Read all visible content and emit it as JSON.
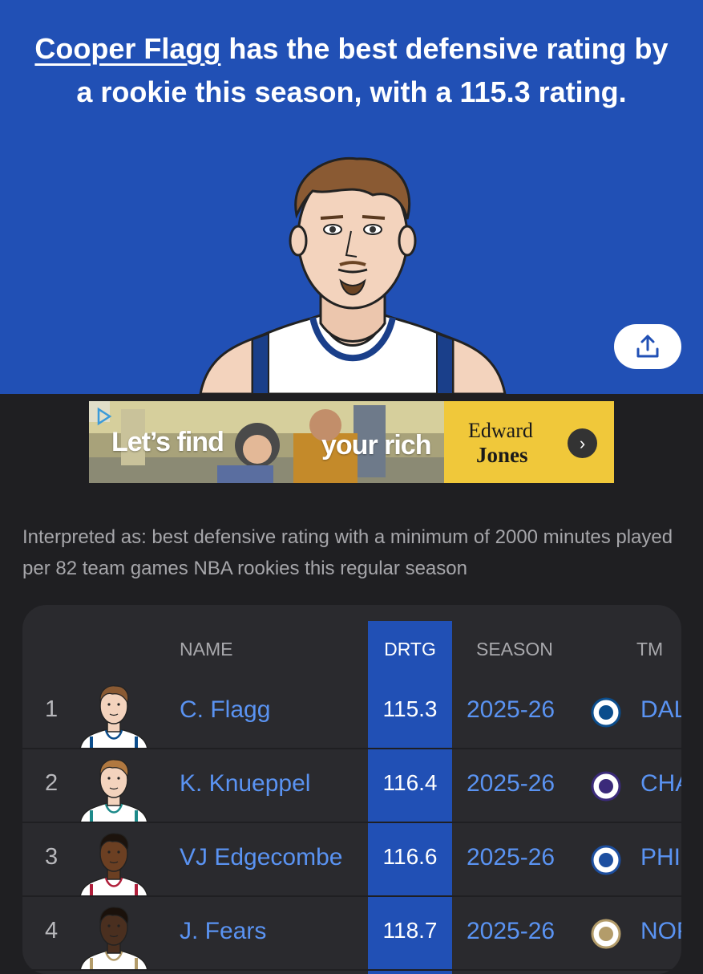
{
  "headline": {
    "player_link": "Cooper Flagg",
    "rest": " has the best defensive rating by a rookie this season, with a 115.3 rating."
  },
  "ad": {
    "text_left": "Let’s find",
    "text_right": "your rich",
    "brand_line1": "Edward",
    "brand_line2": "Jones",
    "arrow": "›"
  },
  "interpretation": "Interpreted as: best defensive rating with a minimum of 2000 minutes played per 82 team games NBA rookies this regular season",
  "table": {
    "headers": {
      "name": "NAME",
      "drtg": "DRTG",
      "season": "SEASON",
      "team": "TM"
    },
    "rows": [
      {
        "rank": "1",
        "name": "C. Flagg",
        "drtg": "115.3",
        "season": "2025-26",
        "team": "DAL",
        "team_color": "#0b4d8c",
        "skin": "#f3d3bd",
        "hair": "#8a5a33",
        "jersey": "#ffffff",
        "trim": "#0b4d8c"
      },
      {
        "rank": "2",
        "name": "K. Knueppel",
        "drtg": "116.4",
        "season": "2025-26",
        "team": "CHA",
        "team_color": "#3b2a7a",
        "skin": "#f3d3bd",
        "hair": "#b07840",
        "jersey": "#ffffff",
        "trim": "#1d8a8a"
      },
      {
        "rank": "3",
        "name": "VJ Edgecombe",
        "drtg": "116.6",
        "season": "2025-26",
        "team": "PHI",
        "team_color": "#1d4fa0",
        "skin": "#6b3f22",
        "hair": "#1c130d",
        "jersey": "#ffffff",
        "trim": "#b01e3a"
      },
      {
        "rank": "4",
        "name": "J. Fears",
        "drtg": "118.7",
        "season": "2025-26",
        "team": "NOP",
        "team_color": "#b39c6a",
        "skin": "#4a2f1f",
        "hair": "#1a110b",
        "jersey": "#ffffff",
        "trim": "#b39c6a"
      }
    ]
  },
  "colors": {
    "hero_bg": "#2150b5",
    "link_blue": "#5a93f2",
    "page_bg": "#1f1f22"
  }
}
